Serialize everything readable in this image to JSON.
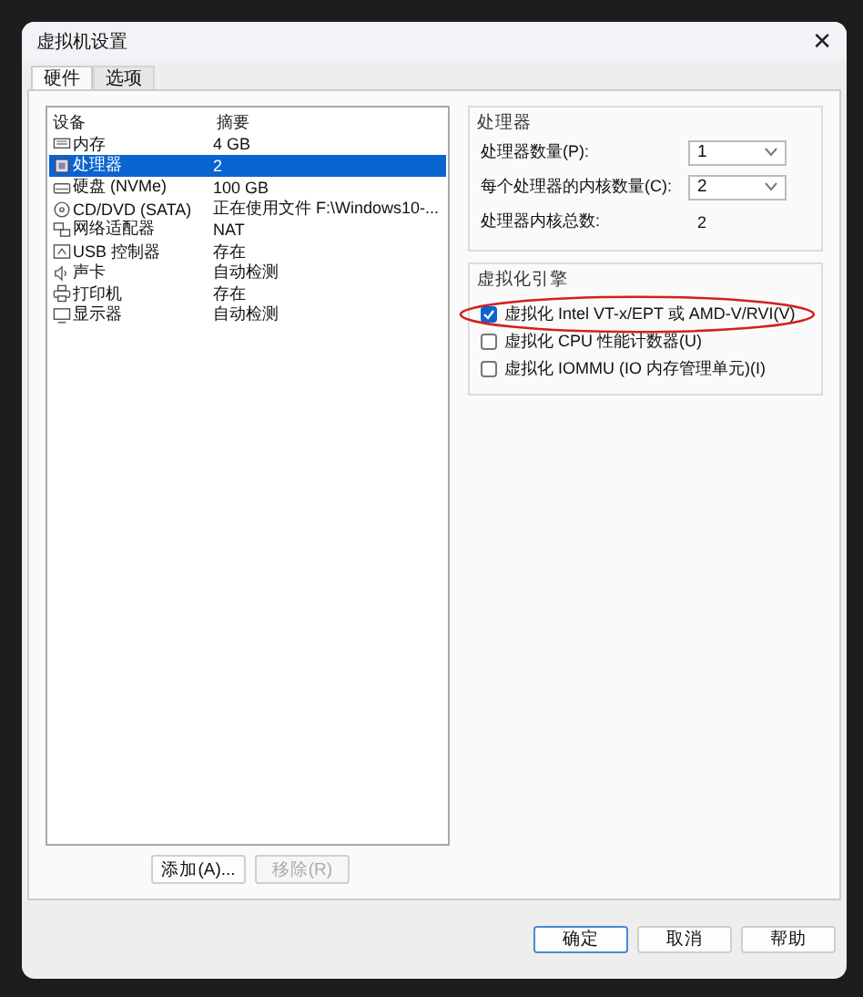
{
  "window": {
    "title": "虚拟机设置",
    "close": "✕"
  },
  "tabs": [
    {
      "label": "硬件",
      "selected": true
    },
    {
      "label": "选项",
      "selected": false
    }
  ],
  "device_list": {
    "columns": [
      "设备",
      "摘要"
    ],
    "rows": [
      {
        "kind": "memory",
        "device": "内存",
        "summary": "4 GB",
        "selected": false
      },
      {
        "kind": "cpu",
        "device": "处理器",
        "summary": "2",
        "selected": true
      },
      {
        "kind": "disk",
        "device": "硬盘 (NVMe)",
        "summary": "100 GB",
        "selected": false
      },
      {
        "kind": "cd",
        "device": "CD/DVD (SATA)",
        "summary": "正在使用文件 F:\\Windows10-...",
        "selected": false
      },
      {
        "kind": "network",
        "device": "网络适配器",
        "summary": "NAT",
        "selected": false
      },
      {
        "kind": "usb",
        "device": "USB 控制器",
        "summary": "存在",
        "selected": false
      },
      {
        "kind": "sound",
        "device": "声卡",
        "summary": "自动检测",
        "selected": false
      },
      {
        "kind": "printer",
        "device": "打印机",
        "summary": "存在",
        "selected": false
      },
      {
        "kind": "display",
        "device": "显示器",
        "summary": "自动检测",
        "selected": false
      }
    ],
    "buttons": [
      {
        "label": "添加(A)...",
        "disabled": false
      },
      {
        "label": "移除(R)",
        "disabled": true
      }
    ]
  },
  "processors": {
    "title": "处理器",
    "fields": [
      {
        "kind": "select",
        "label": "处理器数量(P):",
        "value": "1"
      },
      {
        "kind": "select",
        "label": "每个处理器的内核数量(C):",
        "value": "2"
      },
      {
        "kind": "text",
        "label": "处理器内核总数:",
        "value": "2"
      }
    ]
  },
  "virtualization": {
    "title": "虚拟化引擎",
    "options": [
      {
        "label": "虚拟化 Intel VT-x/EPT 或 AMD-V/RVI(V)",
        "checked": true,
        "circled": true
      },
      {
        "label": "虚拟化 CPU 性能计数器(U)",
        "checked": false,
        "circled": false
      },
      {
        "label": "虚拟化 IOMMU (IO 内存管理单元)(I)",
        "checked": false,
        "circled": false
      }
    ]
  },
  "footer_buttons": [
    {
      "label": "确定",
      "default": true
    },
    {
      "label": "取消",
      "default": false
    },
    {
      "label": "帮助",
      "default": false
    }
  ]
}
